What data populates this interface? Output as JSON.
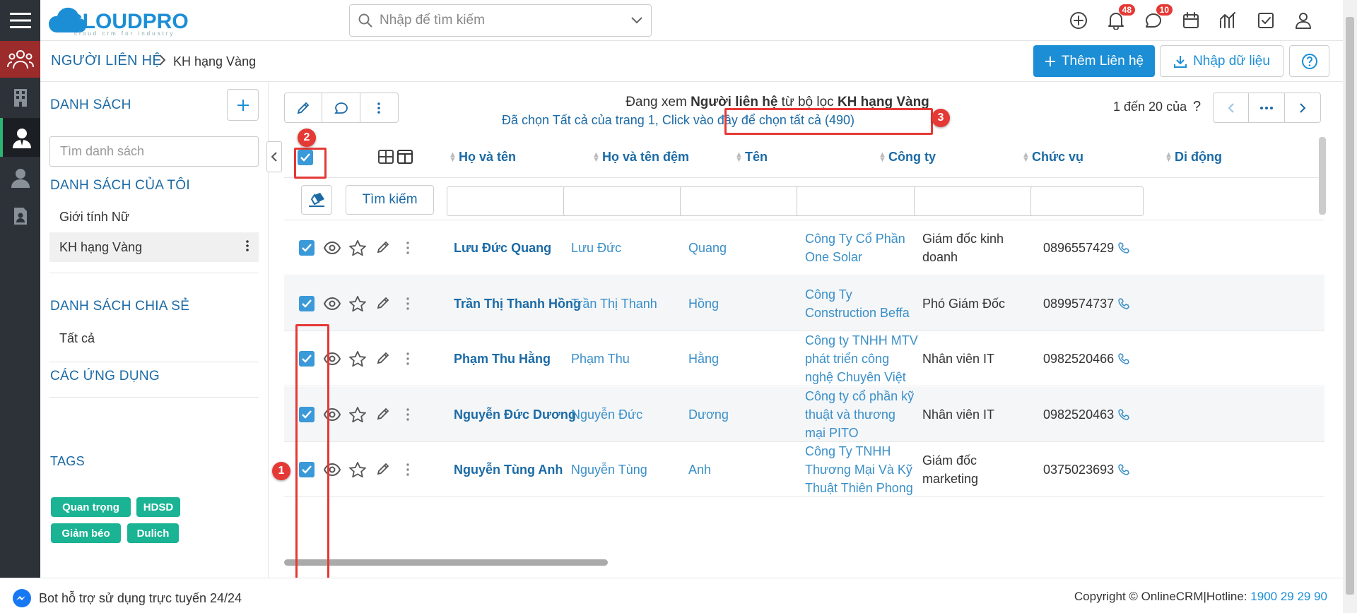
{
  "app": {
    "logo": "CLOUDPRO",
    "logo_sub": "cloud crm for industry"
  },
  "search": {
    "placeholder": "Nhập để tìm kiếm"
  },
  "toolbar": {
    "notif_count": "48",
    "msg_count": "10"
  },
  "breadcrumb": {
    "module": "NGƯỜI LIÊN HỆ",
    "current": "KH hạng Vàng"
  },
  "header_actions": {
    "add_label": "Thêm Liên hệ",
    "import_label": "Nhập dữ liệu"
  },
  "sidebar": {
    "lists_title": "DANH SÁCH",
    "search_placeholder": "Tìm danh sách",
    "my_lists_title": "DANH SÁCH CỦA TÔI",
    "my_lists": [
      "Giới tính Nữ",
      "KH hạng Vàng"
    ],
    "shared_title": "DANH SÁCH CHIA SẺ",
    "shared": [
      "Tất cả"
    ],
    "apps_title": "CÁC ỨNG DỤNG",
    "tags_title": "TAGS",
    "tags": [
      "Quan trọng",
      "HDSD",
      "Giảm béo",
      "Dulich"
    ]
  },
  "view": {
    "prefix": "Đang xem ",
    "module": "Người liên hệ",
    "mid": " từ bộ lọc ",
    "filter": "KH hạng Vàng",
    "selected_note": "Đã chọn Tất cả của trang 1,",
    "select_all_link": "Click vào đây để chọn tất cả (490)"
  },
  "pager": {
    "label": "1 đến 20 của",
    "q": "?"
  },
  "table": {
    "columns": [
      "Họ và tên",
      "Họ và tên đệm",
      "Tên",
      "Công ty",
      "Chức vụ",
      "Di động"
    ],
    "search_button": "Tìm kiếm",
    "rows": [
      {
        "full": "Lưu Đức Quang",
        "middle": "Lưu Đức",
        "first": "Quang",
        "company": "Công Ty Cổ Phần One Solar",
        "title": "Giám đốc kinh doanh",
        "phone": "0896557429"
      },
      {
        "full": "Trần Thị Thanh Hồng",
        "middle": "Trần Thị Thanh",
        "first": "Hồng",
        "company": "Công Ty Construction Beffa",
        "title": "Phó Giám Đốc",
        "phone": "0899574737"
      },
      {
        "full": "Phạm Thu Hằng",
        "middle": "Phạm Thu",
        "first": "Hằng",
        "company": "Công ty TNHH MTV phát triển công nghệ Chuyên Việt",
        "title": "Nhân viên IT",
        "phone": "0982520466"
      },
      {
        "full": "Nguyễn Đức Dương",
        "middle": "Nguyễn Đức",
        "first": "Dương",
        "company": "Công ty cổ phần kỹ thuật và thương mại PITO",
        "title": "Nhân viên IT",
        "phone": "0982520463"
      },
      {
        "full": "Nguyễn Tùng Anh",
        "middle": "Nguyễn Tùng",
        "first": "Anh",
        "company": "Công Ty TNHH Thương Mại Và Kỹ Thuật Thiên Phong",
        "title": "Giám đốc marketing",
        "phone": "0375023693"
      }
    ]
  },
  "annotations": [
    "1",
    "2",
    "3"
  ],
  "footer": {
    "bot": "Bot hỗ trợ sử dụng trực tuyến 24/24",
    "copyright": "Copyright © OnlineCRM|Hotline: ",
    "hotline": "1900 29 29 90"
  },
  "colors": {
    "brand": "#1b8ed6",
    "heading": "#1b6aa5",
    "tag": "#1ab394",
    "annotation": "#e53935"
  }
}
